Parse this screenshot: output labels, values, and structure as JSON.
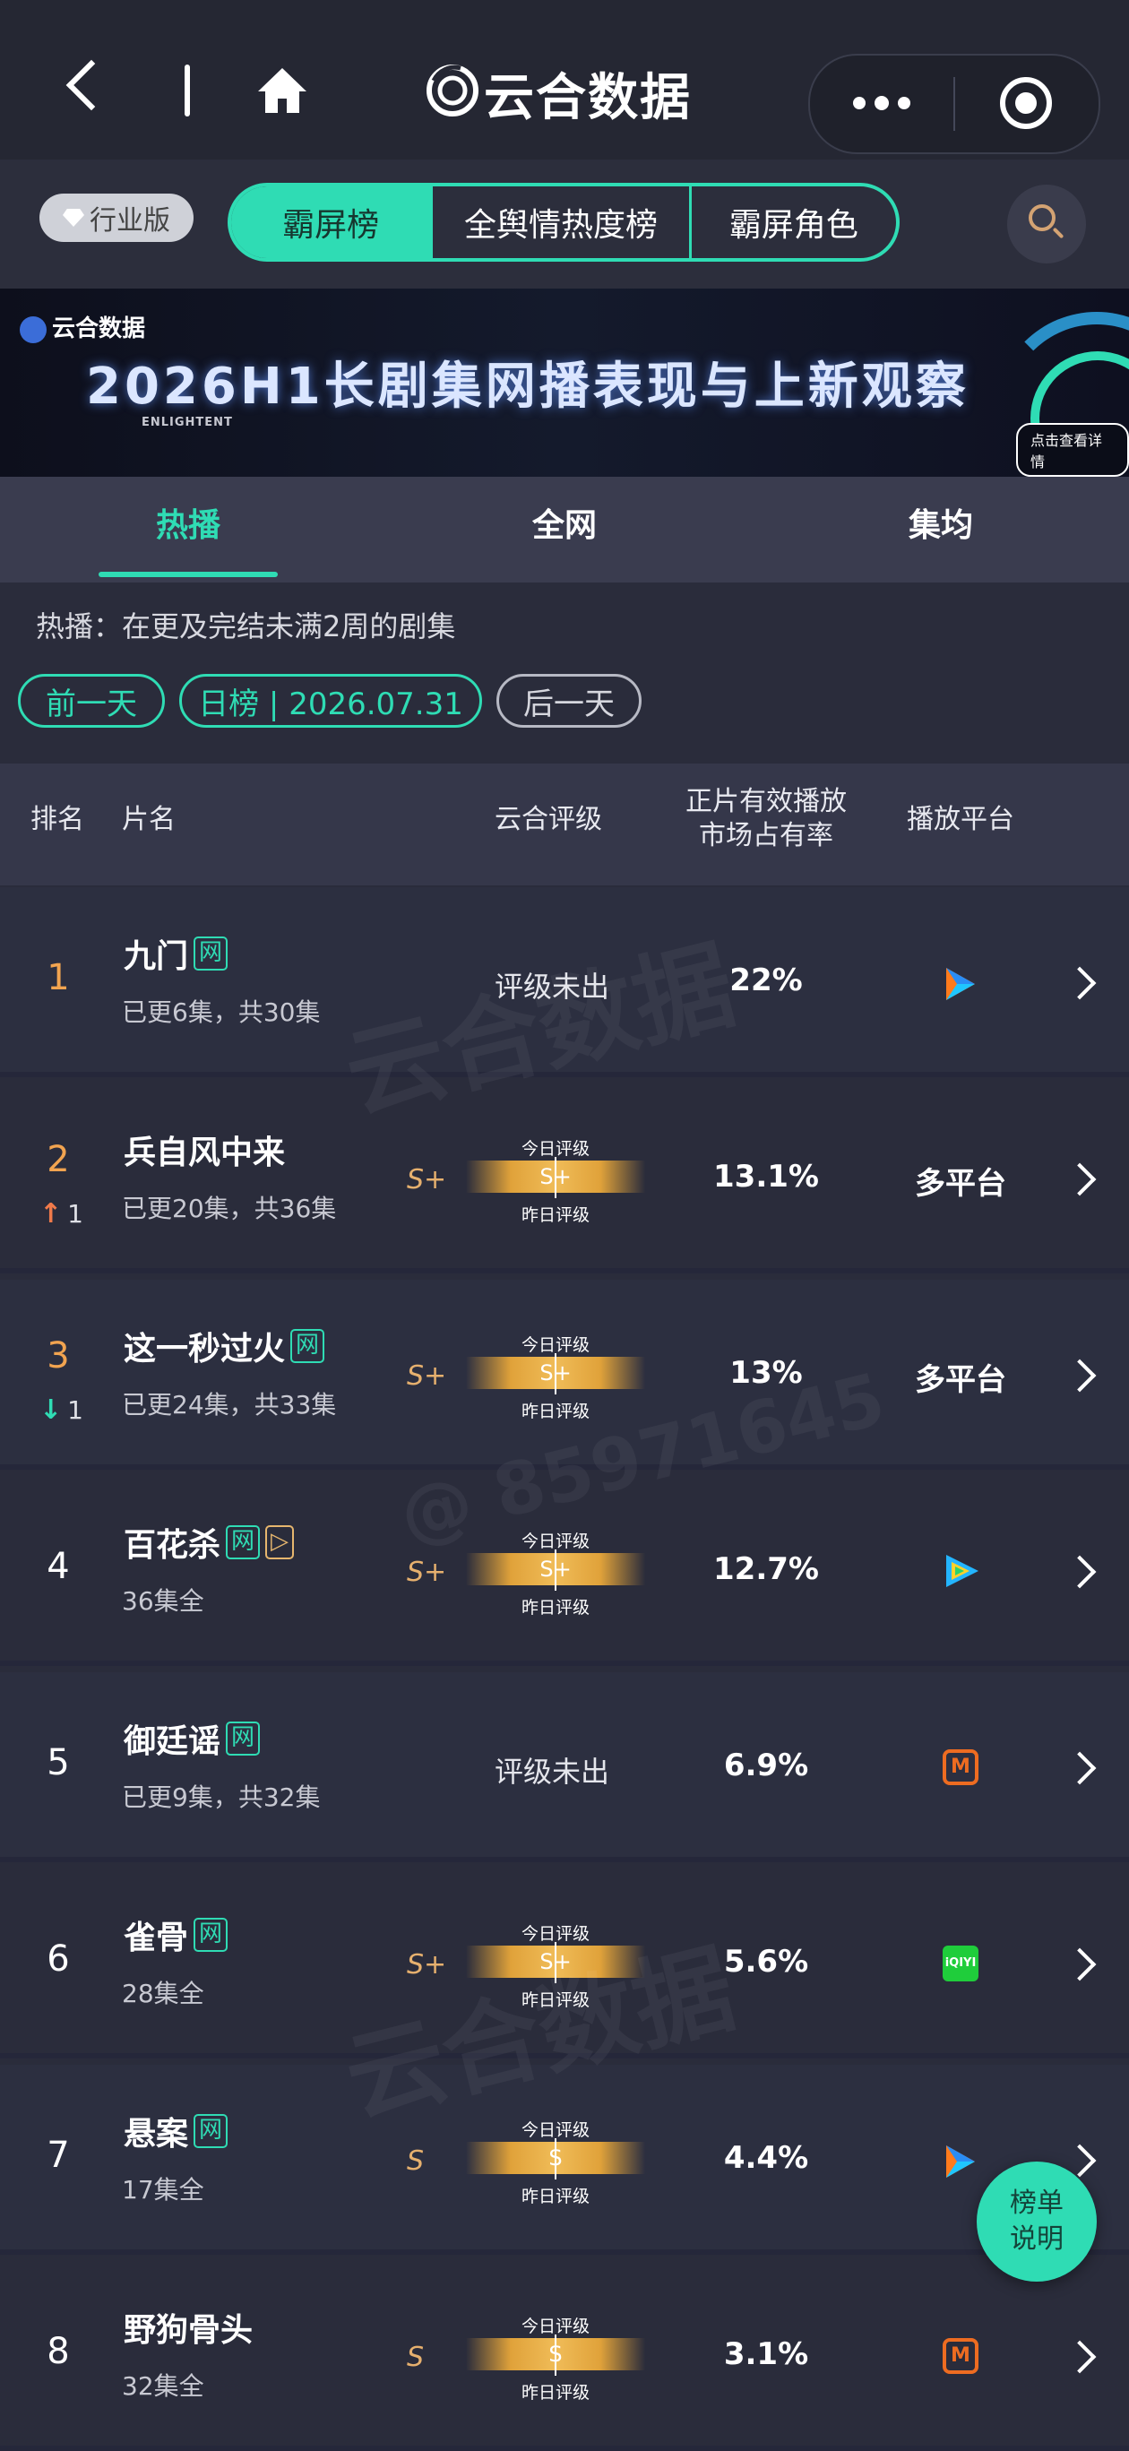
{
  "header": {
    "title": "云合数据",
    "icons": [
      "back-icon",
      "home-icon",
      "more-icon",
      "target-icon"
    ]
  },
  "tabs_row": {
    "industry_badge": "行业版",
    "segments": [
      "霸屏榜",
      "全舆情热度榜",
      "霸屏角色"
    ],
    "active_segment": "霸屏榜"
  },
  "banner": {
    "logo_text": "云合数据",
    "logo_sub": "ENLIGHTENT",
    "title": "2026H1长剧集网播表现与上新观察",
    "cta": "点击查看详情"
  },
  "subtabs": [
    "热播",
    "全网",
    "集均"
  ],
  "active_subtab": "热播",
  "note": "热播：在更及完结未满2周的剧集",
  "date_nav": {
    "prev": "前一天",
    "current": "日榜 | 2026.07.31",
    "next": "后一天"
  },
  "table_header": {
    "rank": "排名",
    "name": "片名",
    "rating": "云合评级",
    "share_line1": "正片有效播放",
    "share_line2": "市场占有率",
    "platform": "播放平台"
  },
  "rating_labels": {
    "today": "今日评级",
    "yesterday": "昨日评级"
  },
  "rows": [
    {
      "rank": "1",
      "title": "九门",
      "tags": [
        "网"
      ],
      "sub": "已更6集，共30集",
      "rating_none": "评级未出",
      "grade": "",
      "bar_grade": "",
      "share": "22%",
      "platform": "",
      "platform_icon": "tencent-video-icon",
      "trend": "",
      "trend_dir": ""
    },
    {
      "rank": "2",
      "title": "兵自风中来",
      "tags": [],
      "sub": "已更20集，共36集",
      "rating_none": "",
      "grade": "S+",
      "bar_grade": "S+",
      "share": "13.1%",
      "platform": "多平台",
      "platform_icon": "",
      "trend": "1",
      "trend_dir": "up"
    },
    {
      "rank": "3",
      "title": "这一秒过火",
      "tags": [
        "网"
      ],
      "sub": "已更24集，共33集",
      "rating_none": "",
      "grade": "S+",
      "bar_grade": "S+",
      "share": "13%",
      "platform": "多平台",
      "platform_icon": "",
      "trend": "1",
      "trend_dir": "down"
    },
    {
      "rank": "4",
      "title": "百花杀",
      "tags": [
        "网",
        "▷"
      ],
      "sub": "36集全",
      "rating_none": "",
      "grade": "S+",
      "bar_grade": "S+",
      "share": "12.7%",
      "platform": "",
      "platform_icon": "tencent-play-icon",
      "trend": "",
      "trend_dir": ""
    },
    {
      "rank": "5",
      "title": "御廷谣",
      "tags": [
        "网"
      ],
      "sub": "已更9集，共32集",
      "rating_none": "评级未出",
      "grade": "",
      "bar_grade": "",
      "share": "6.9%",
      "platform": "",
      "platform_icon": "mango-tv-icon",
      "trend": "",
      "trend_dir": ""
    },
    {
      "rank": "6",
      "title": "雀骨",
      "tags": [
        "网"
      ],
      "sub": "28集全",
      "rating_none": "",
      "grade": "S+",
      "bar_grade": "S+",
      "share": "5.6%",
      "platform": "",
      "platform_icon": "iqiyi-icon",
      "iq_text": "iQIYI",
      "trend": "",
      "trend_dir": ""
    },
    {
      "rank": "7",
      "title": "悬案",
      "tags": [
        "网"
      ],
      "sub": "17集全",
      "rating_none": "",
      "grade": "S",
      "bar_grade": "S",
      "share": "4.4%",
      "platform": "",
      "platform_icon": "tencent-video-icon",
      "trend": "",
      "trend_dir": ""
    },
    {
      "rank": "8",
      "title": "野狗骨头",
      "tags": [],
      "sub": "32集全",
      "rating_none": "",
      "grade": "S",
      "bar_grade": "S",
      "share": "3.1%",
      "platform": "",
      "platform_icon": "mango-tv-icon",
      "trend": "",
      "trend_dir": ""
    }
  ],
  "fab": {
    "line1": "榜单",
    "line2": "说明"
  },
  "watermarks": [
    "云合数据",
    "ENLIGHTENT",
    "@ 85971645"
  ],
  "colors": {
    "accent": "#2fdcb4",
    "gold": "#f2a450",
    "grade": "#e6b06e",
    "background": "#2a2c3b"
  }
}
